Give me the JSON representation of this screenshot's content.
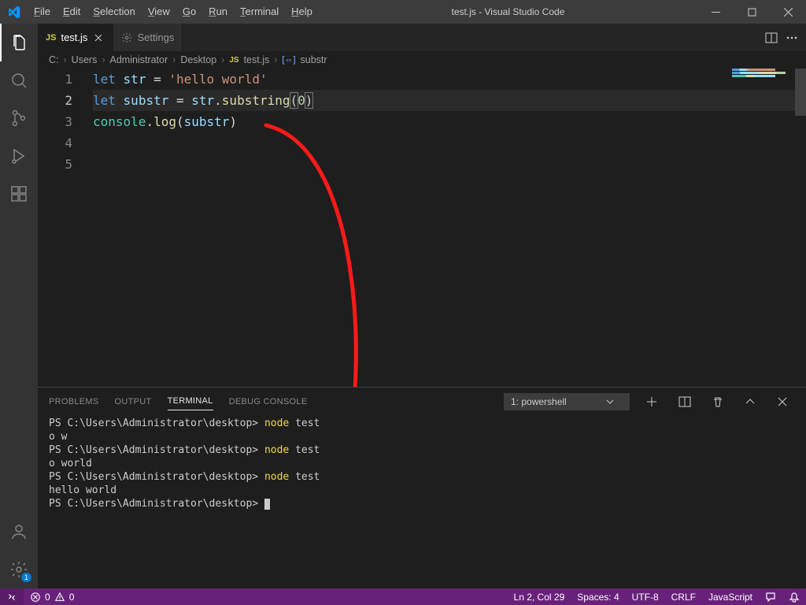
{
  "window": {
    "title": "test.js - Visual Studio Code"
  },
  "menubar": [
    "File",
    "Edit",
    "Selection",
    "View",
    "Go",
    "Run",
    "Terminal",
    "Help"
  ],
  "tabs": [
    {
      "label": "test.js",
      "icon": "JS",
      "active": true,
      "dirty": false
    },
    {
      "label": "Settings",
      "icon": "gear",
      "active": false
    }
  ],
  "breadcrumbs": {
    "parts": [
      "C:",
      "Users",
      "Administrator",
      "Desktop"
    ],
    "file": "test.js",
    "symbol": "substr"
  },
  "code": {
    "lines": [
      {
        "n": 1,
        "tokens": [
          [
            "kw",
            "let"
          ],
          [
            "op",
            " "
          ],
          [
            "var",
            "str"
          ],
          [
            "op",
            " = "
          ],
          [
            "str",
            "'hello world'"
          ]
        ]
      },
      {
        "n": 2,
        "current": true,
        "tokens": [
          [
            "kw",
            "let"
          ],
          [
            "op",
            " "
          ],
          [
            "var",
            "substr"
          ],
          [
            "op",
            " = "
          ],
          [
            "var",
            "str"
          ],
          [
            "op",
            "."
          ],
          [
            "fn",
            "substring"
          ],
          [
            "brmatch",
            "("
          ],
          [
            "num",
            "0"
          ],
          [
            "brmatch",
            ")"
          ]
        ]
      },
      {
        "n": 3,
        "tokens": [
          [
            "obj",
            "console"
          ],
          [
            "op",
            "."
          ],
          [
            "fn",
            "log"
          ],
          [
            "op",
            "("
          ],
          [
            "var",
            "substr"
          ],
          [
            "op",
            ")"
          ]
        ]
      },
      {
        "n": 4,
        "tokens": []
      },
      {
        "n": 5,
        "tokens": []
      }
    ]
  },
  "panel": {
    "tabs": [
      "PROBLEMS",
      "OUTPUT",
      "TERMINAL",
      "DEBUG CONSOLE"
    ],
    "active": "TERMINAL",
    "selector": "1: powershell",
    "terminal": [
      {
        "type": "cmd",
        "prompt": "PS C:\\Users\\Administrator\\desktop>",
        "cmd": "node",
        "arg": " test"
      },
      {
        "type": "out",
        "text": "o w"
      },
      {
        "type": "cmd",
        "prompt": "PS C:\\Users\\Administrator\\desktop>",
        "cmd": "node",
        "arg": " test"
      },
      {
        "type": "out",
        "text": "o world"
      },
      {
        "type": "cmd",
        "prompt": "PS C:\\Users\\Administrator\\desktop>",
        "cmd": "node",
        "arg": " test"
      },
      {
        "type": "out",
        "text": "hello world"
      },
      {
        "type": "prompt",
        "prompt": "PS C:\\Users\\Administrator\\desktop>"
      }
    ]
  },
  "status": {
    "errors": "0",
    "warnings": "0",
    "position": "Ln 2, Col 29",
    "spaces": "Spaces: 4",
    "encoding": "UTF-8",
    "eol": "CRLF",
    "lang": "JavaScript"
  }
}
